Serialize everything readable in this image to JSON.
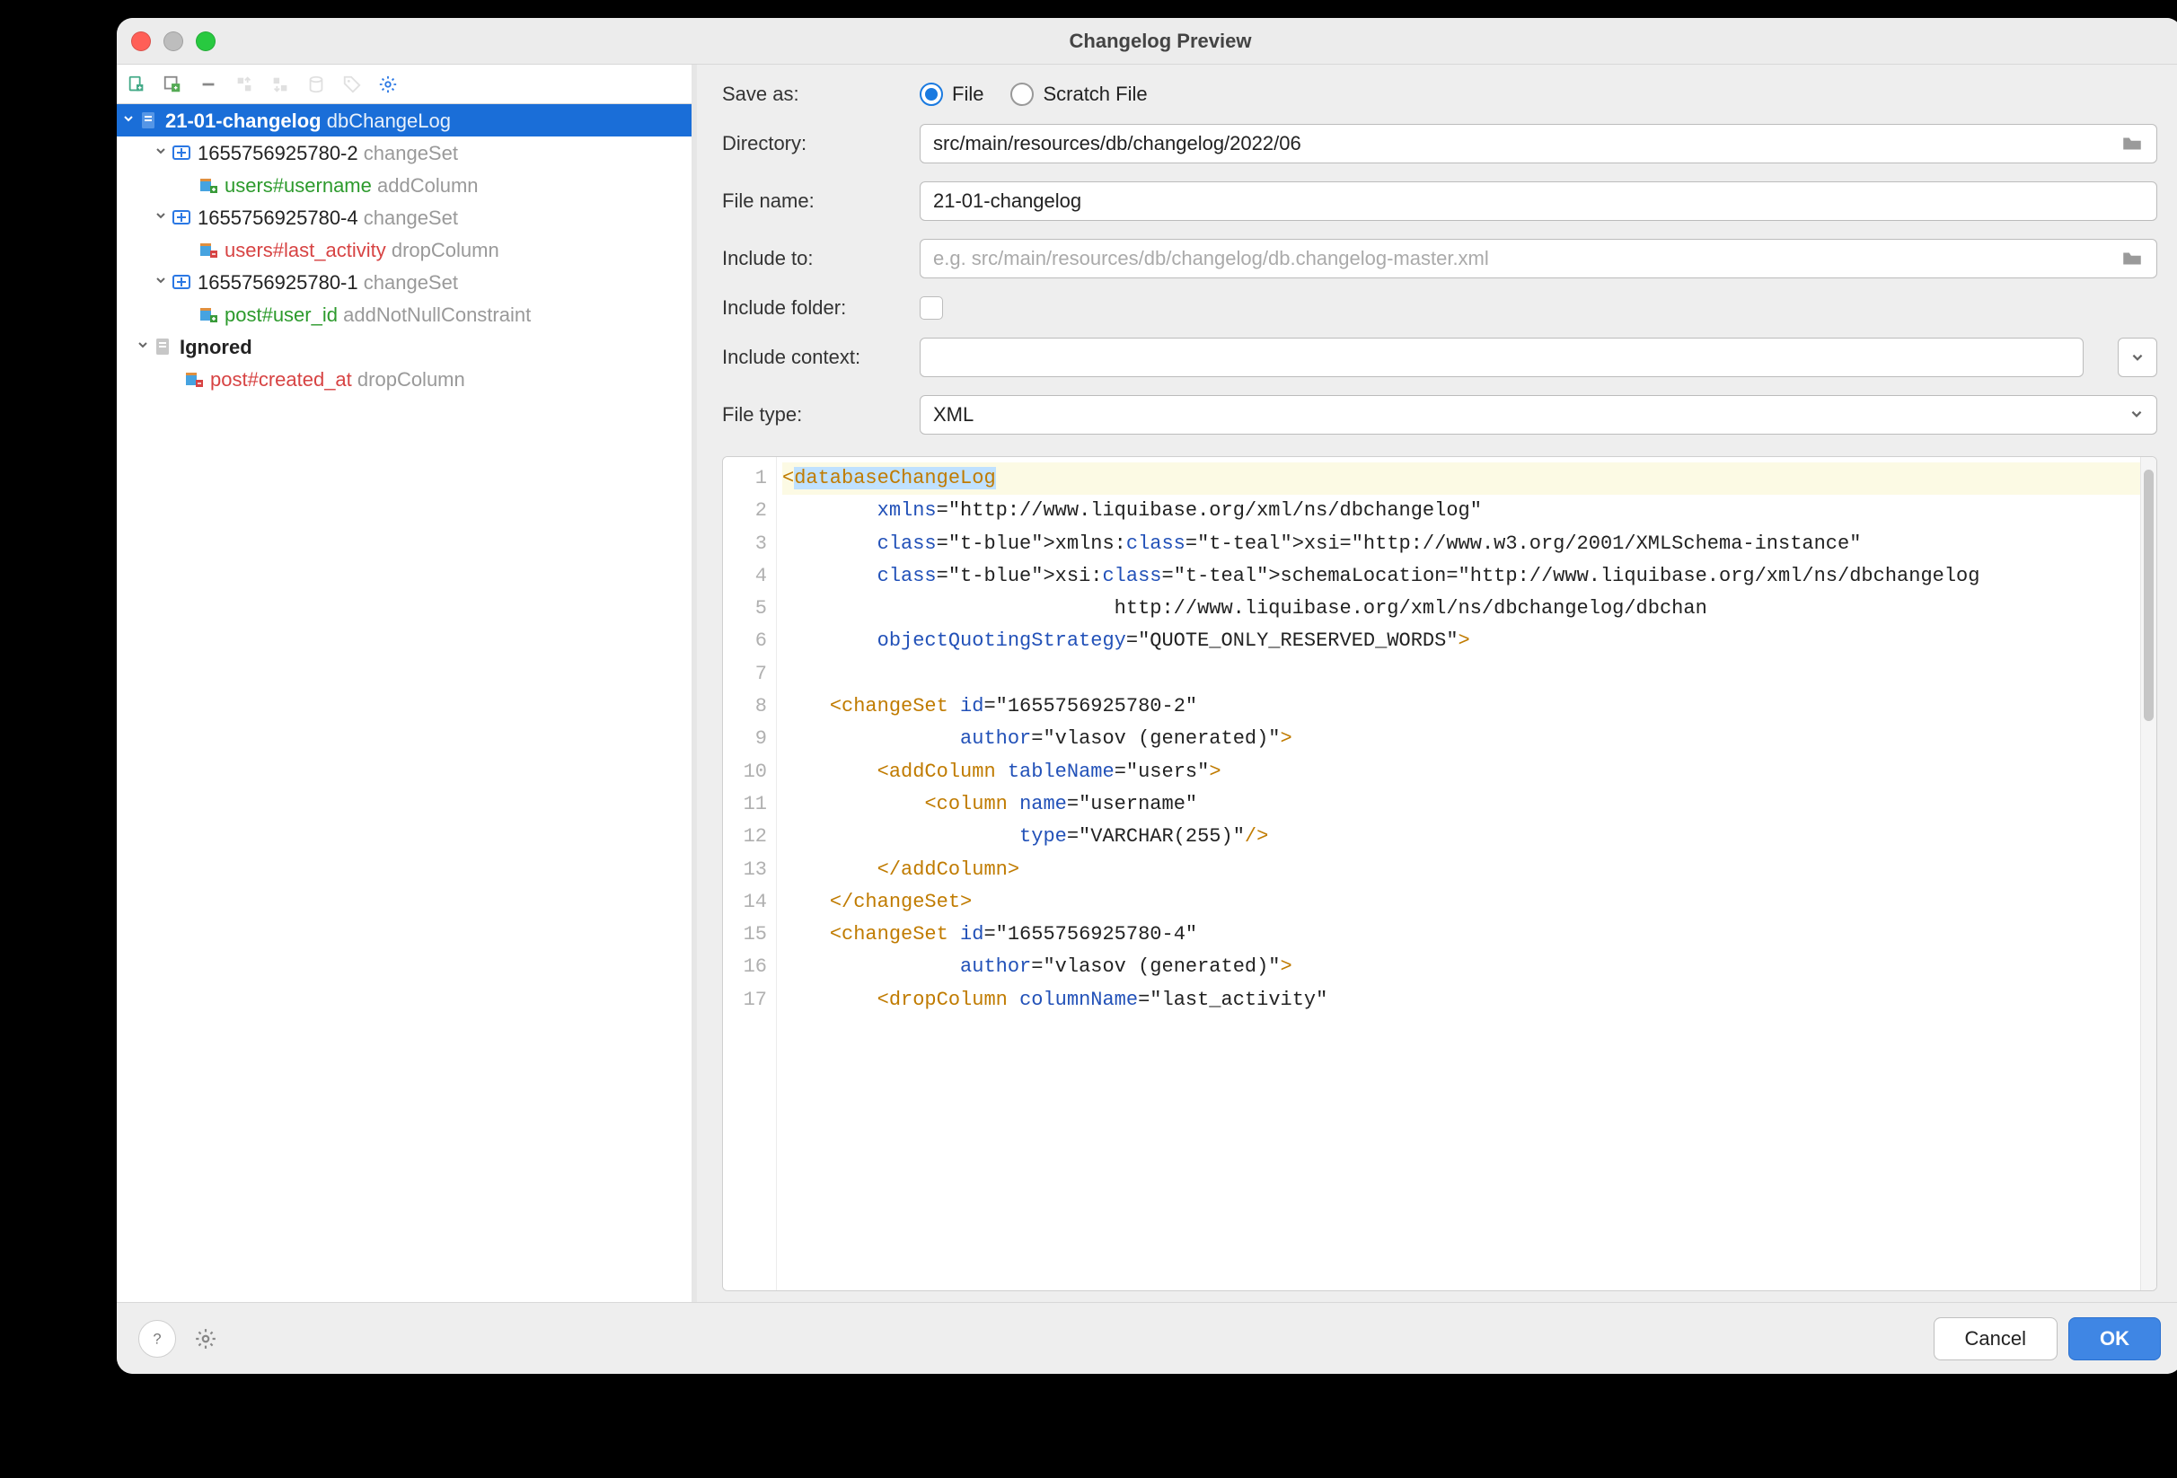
{
  "window": {
    "title": "Changelog Preview"
  },
  "tree": {
    "root": {
      "name": "21-01-changelog",
      "type": "dbChangeLog"
    },
    "sets": [
      {
        "id": "1655756925780-2",
        "type": "changeSet",
        "child": {
          "ref": "users#username",
          "op": "addColumn",
          "color": "green"
        }
      },
      {
        "id": "1655756925780-4",
        "type": "changeSet",
        "child": {
          "ref": "users#last_activity",
          "op": "dropColumn",
          "color": "red"
        }
      },
      {
        "id": "1655756925780-1",
        "type": "changeSet",
        "child": {
          "ref": "post#user_id",
          "op": "addNotNullConstraint",
          "color": "green"
        }
      }
    ],
    "ignored": {
      "label": "Ignored",
      "children": [
        {
          "ref": "post#created_at",
          "op": "dropColumn",
          "color": "red"
        }
      ]
    }
  },
  "form": {
    "saveAsLabel": "Save as:",
    "saveAsFile": "File",
    "saveAsScratch": "Scratch File",
    "directoryLabel": "Directory:",
    "directoryValue": "src/main/resources/db/changelog/2022/06",
    "fileNameLabel": "File name:",
    "fileNameValue": "21-01-changelog",
    "includeToLabel": "Include to:",
    "includeToPlaceholder": "e.g. src/main/resources/db/changelog/db.changelog-master.xml",
    "includeFolderLabel": "Include folder:",
    "includeContextLabel": "Include context:",
    "fileTypeLabel": "File type:",
    "fileTypeValue": "XML"
  },
  "editor": {
    "lines": [
      "<databaseChangeLog",
      "        xmlns=\"http://www.liquibase.org/xml/ns/dbchangelog\"",
      "        xmlns:xsi=\"http://www.w3.org/2001/XMLSchema-instance\"",
      "        xsi:schemaLocation=\"http://www.liquibase.org/xml/ns/dbchangelog",
      "                            http://www.liquibase.org/xml/ns/dbchangelog/dbchan",
      "        objectQuotingStrategy=\"QUOTE_ONLY_RESERVED_WORDS\">",
      "",
      "    <changeSet id=\"1655756925780-2\"",
      "               author=\"vlasov (generated)\">",
      "        <addColumn tableName=\"users\">",
      "            <column name=\"username\"",
      "                    type=\"VARCHAR(255)\"/>",
      "        </addColumn>",
      "    </changeSet>",
      "    <changeSet id=\"1655756925780-4\"",
      "               author=\"vlasov (generated)\">",
      "        <dropColumn columnName=\"last_activity\""
    ]
  },
  "footer": {
    "cancel": "Cancel",
    "ok": "OK"
  }
}
